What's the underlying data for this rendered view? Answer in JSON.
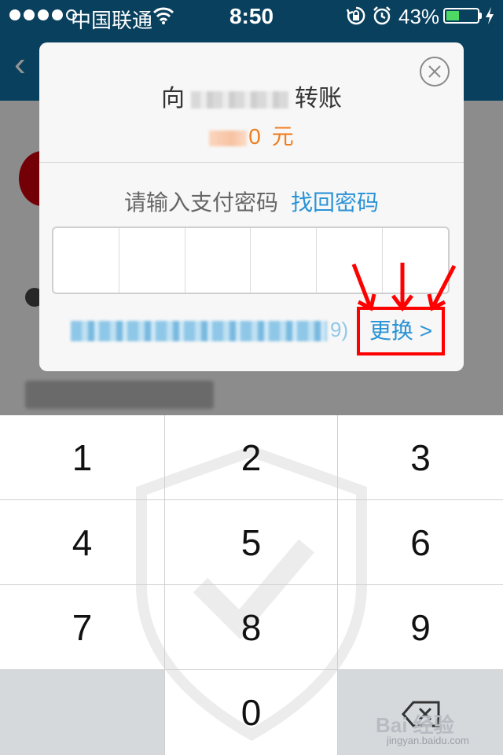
{
  "status_bar": {
    "carrier": "中国联通",
    "time": "8:50",
    "battery_percent": "43%",
    "battery_level": 0.43,
    "signal_strength": 4,
    "icons": [
      "signal-dots-icon",
      "wifi-icon",
      "rotation-lock-icon",
      "alarm-icon",
      "battery-icon",
      "charging-icon"
    ]
  },
  "dialog": {
    "title_prefix": "向",
    "title_suffix": "转账",
    "amount_visible_digit": "0",
    "amount_unit": "元",
    "password_prompt": "请输入支付密码",
    "recover_link": "找回密码",
    "card_tail": "9)",
    "change_button": "更换 >",
    "close_icon": "close-circle-icon"
  },
  "keypad": {
    "keys": [
      "1",
      "2",
      "3",
      "4",
      "5",
      "6",
      "7",
      "8",
      "9",
      "0"
    ],
    "delete_icon": "backspace-icon"
  },
  "watermark": {
    "brand": "Bai 经验",
    "site": "jingyan.baidu.com"
  },
  "colors": {
    "nav_blue": "#0e6fa3",
    "link_blue": "#2a93d5",
    "amount_orange": "#f07d1f",
    "highlight_red": "#ff0000"
  }
}
